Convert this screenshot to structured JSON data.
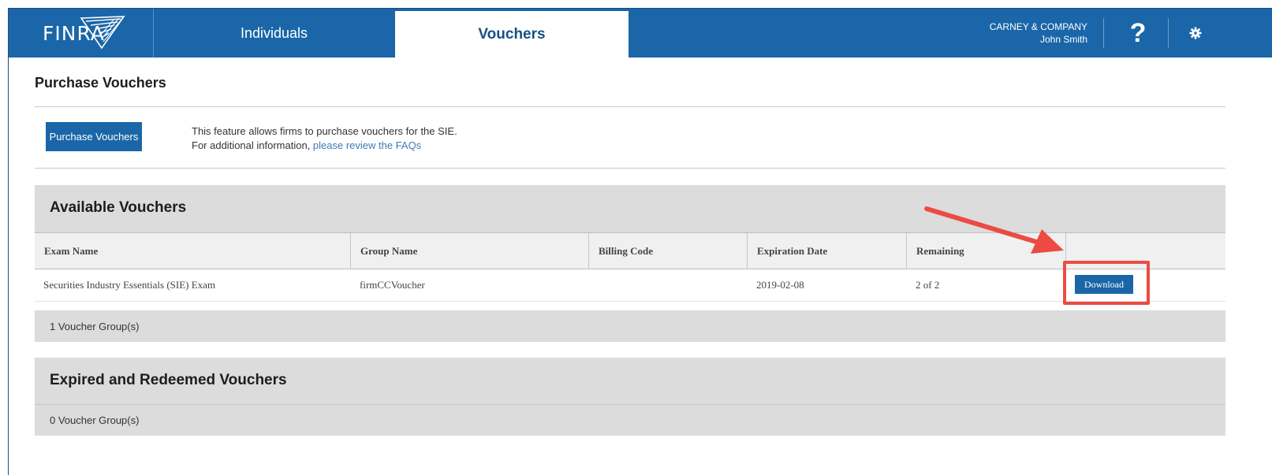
{
  "header": {
    "logo_text": "FINRA",
    "tabs": [
      {
        "label": "Individuals",
        "active": false
      },
      {
        "label": "Vouchers",
        "active": true
      }
    ],
    "company": "CARNEY & COMPANY",
    "user": "John Smith",
    "help_glyph": "?",
    "brand_color": "#1a66a8"
  },
  "page": {
    "title": "Purchase Vouchers",
    "purchase_button": "Purchase Vouchers",
    "description_line1": "This feature allows firms to purchase vouchers for the SIE.",
    "description_line2": "For additional information, ",
    "faq_link": "please review the FAQs"
  },
  "available": {
    "title": "Available Vouchers",
    "columns": [
      "Exam Name",
      "Group Name",
      "Billing Code",
      "Expiration Date",
      "Remaining"
    ],
    "rows": [
      {
        "exam_name": "Securities Industry Essentials (SIE) Exam",
        "group_name": "firmCCVoucher",
        "billing_code": "",
        "expiration_date": "2019-02-08",
        "remaining": "2 of 2",
        "action": "Download"
      }
    ],
    "count": "1 Voucher Group(s)"
  },
  "expired": {
    "title": "Expired and Redeemed Vouchers",
    "count": "0 Voucher Group(s)"
  },
  "annotation": {
    "arrow_color": "#ec4b43",
    "highlight_color": "#ec4b43"
  }
}
